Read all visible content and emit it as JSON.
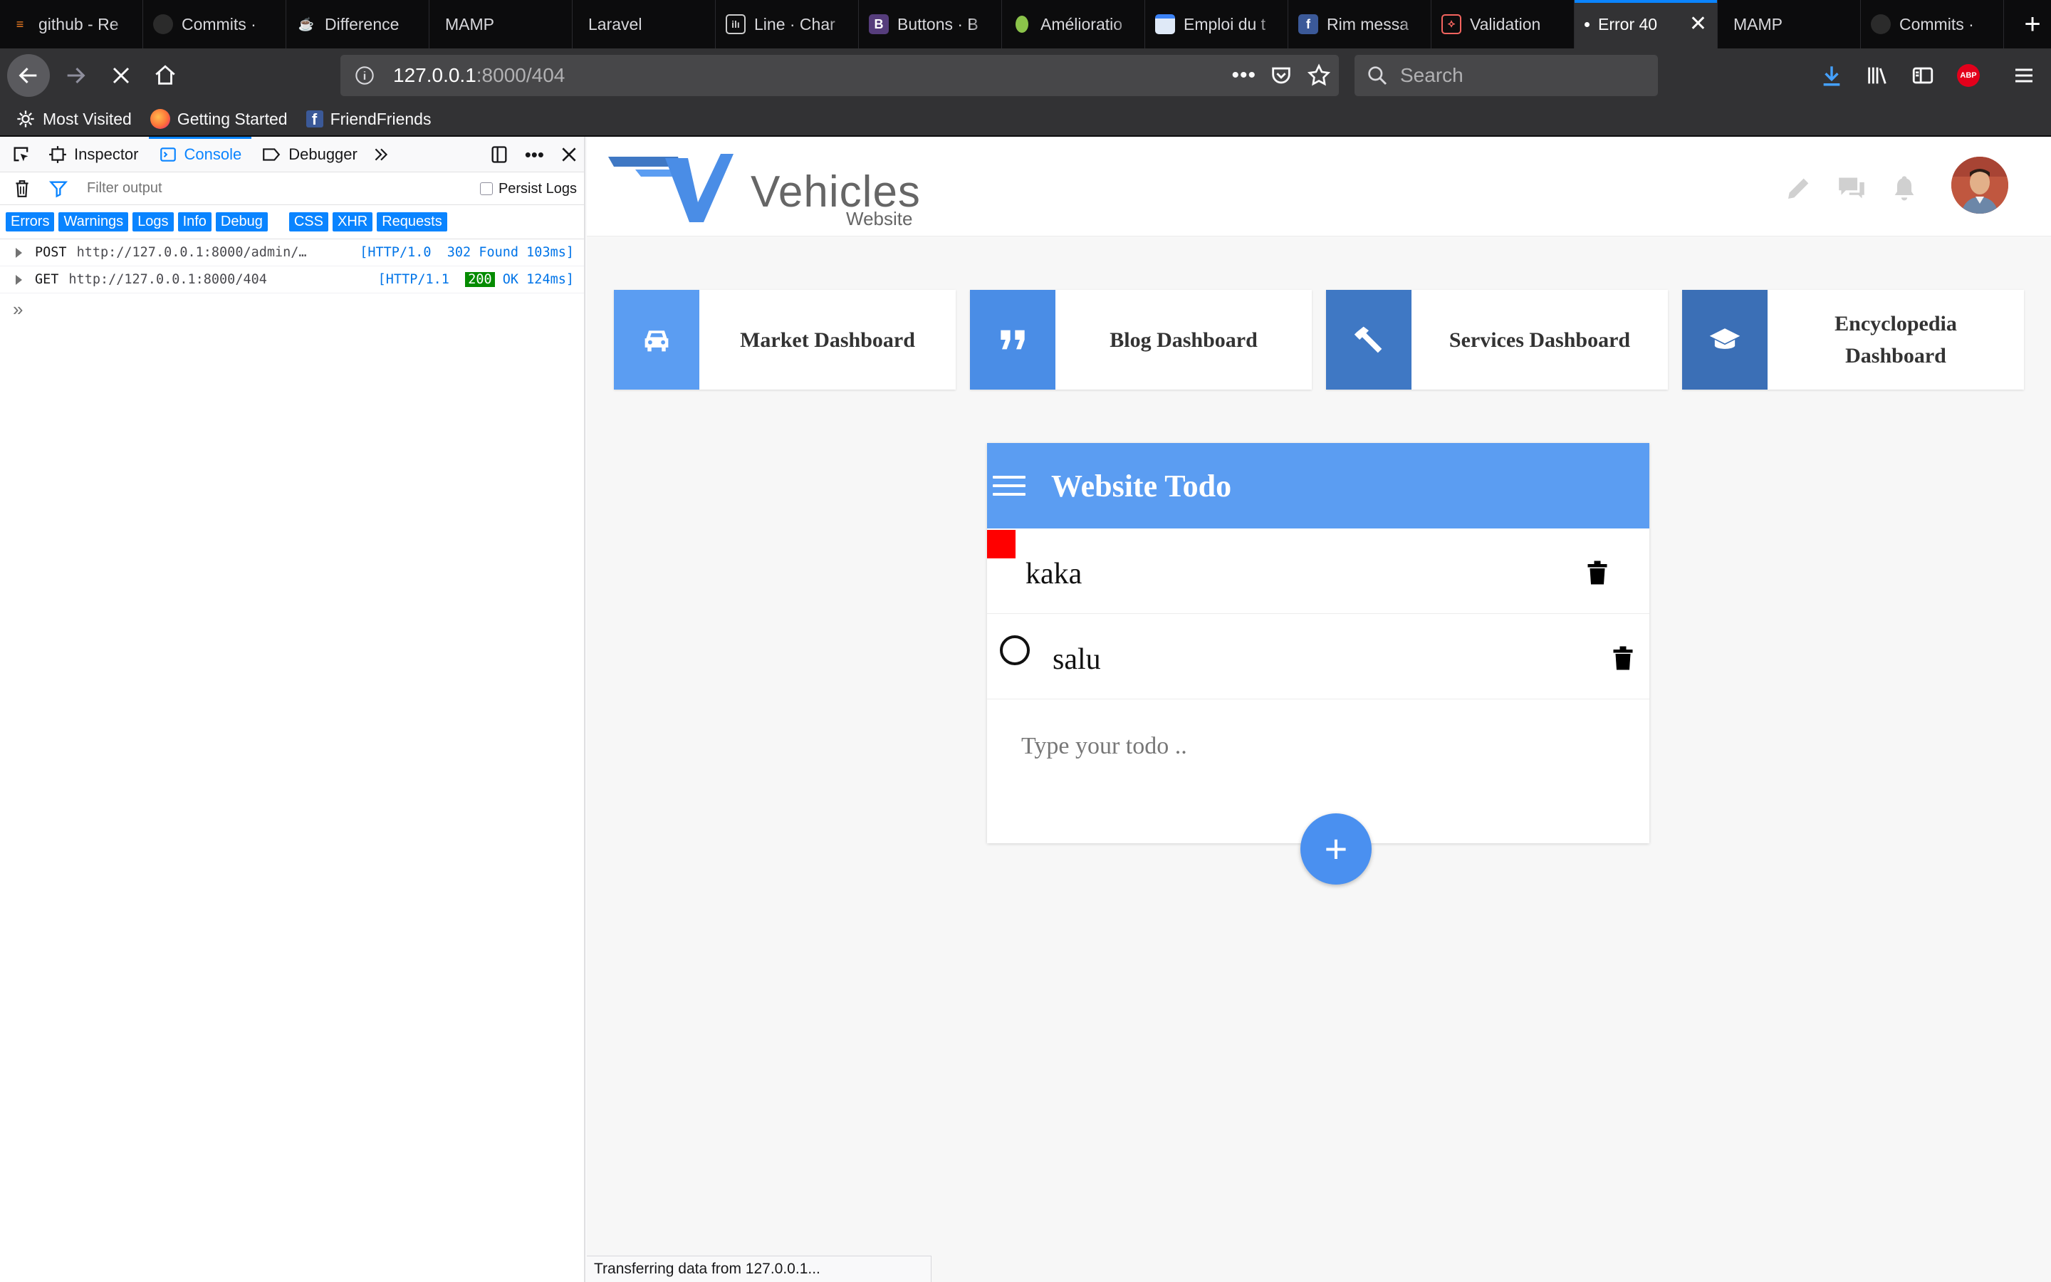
{
  "tabs": [
    {
      "title": "github - Re",
      "icon": "stack-icon",
      "color": "#f48024"
    },
    {
      "title": "Commits · ",
      "icon": "github-icon",
      "color": "#444444"
    },
    {
      "title": "Difference",
      "icon": "coffee-icon",
      "color": "#e8e8e8"
    },
    {
      "title": "MAMP",
      "icon": "",
      "color": ""
    },
    {
      "title": "Laravel",
      "icon": "",
      "color": ""
    },
    {
      "title": "Line · Char",
      "icon": "chart-icon",
      "color": "#cccccc"
    },
    {
      "title": "Buttons · B",
      "icon": "bootstrap-icon",
      "color": "#563d7c"
    },
    {
      "title": "Amélioratio",
      "icon": "avocado-icon",
      "color": "#8bc34a"
    },
    {
      "title": "Emploi du t",
      "icon": "calendar-icon",
      "color": "#3b82f6"
    },
    {
      "title": "Rim messa",
      "icon": "facebook-icon",
      "color": "#3b5998"
    },
    {
      "title": "Validation",
      "icon": "laravel-icon",
      "color": "#f4645f"
    },
    {
      "title": "Error 40",
      "icon": "",
      "color": "",
      "active": true
    },
    {
      "title": "MAMP",
      "icon": "",
      "color": ""
    },
    {
      "title": "Commits · ",
      "icon": "github-icon",
      "color": "#444444"
    }
  ],
  "url": {
    "host": "127.0.0.1",
    "path": ":8000/404"
  },
  "search_placeholder": "Search",
  "bookmarks": [
    {
      "label": "Most Visited",
      "icon": "gear-icon"
    },
    {
      "label": "Getting Started",
      "icon": "firefox-icon"
    },
    {
      "label": "FriendFriends",
      "icon": "facebook-icon"
    }
  ],
  "devtools": {
    "tabs": {
      "inspector": "Inspector",
      "console": "Console",
      "debugger": "Debugger"
    },
    "filter_placeholder": "Filter output",
    "persist_logs": "Persist Logs",
    "filters": [
      "Errors",
      "Warnings",
      "Logs",
      "Info",
      "Debug"
    ],
    "filters2": [
      "CSS",
      "XHR",
      "Requests"
    ],
    "logs": [
      {
        "method": "POST",
        "url": "http://127.0.0.1:8000/admin/…",
        "proto": "[HTTP/1.0",
        "status": "302",
        "text": "Found 103ms]",
        "status_badge": false
      },
      {
        "method": "GET",
        "url": "http://127.0.0.1:8000/404",
        "proto": "[HTTP/1.1",
        "status": "200",
        "text": "OK 124ms]",
        "status_badge": true
      }
    ],
    "prompt": "»"
  },
  "site": {
    "logo_text": "Vehicles",
    "logo_sub": "Website",
    "colors": {
      "blue": "#5b9df2",
      "blue_dark": "#3f78c4",
      "red": "#ff0000"
    }
  },
  "dashboards": [
    {
      "label": "Market Dashboard",
      "icon": "car-icon",
      "color": "#5b9df2"
    },
    {
      "label": "Blog Dashboard",
      "icon": "quote-icon",
      "color": "#4a8de6"
    },
    {
      "label": "Services Dashboard",
      "icon": "hammer-icon",
      "color": "#3f78c4"
    },
    {
      "label": "Encyclopedia Dashboard",
      "icon": "graduation-cap-icon",
      "color": "#3b6fb6"
    }
  ],
  "todo": {
    "title": "Website Todo",
    "items": [
      {
        "text": "kaka",
        "done": true
      },
      {
        "text": "salu",
        "done": false
      }
    ],
    "input_placeholder": "Type your todo ..",
    "add_label": "+"
  },
  "status_text": "Transferring data from 127.0.0.1..."
}
